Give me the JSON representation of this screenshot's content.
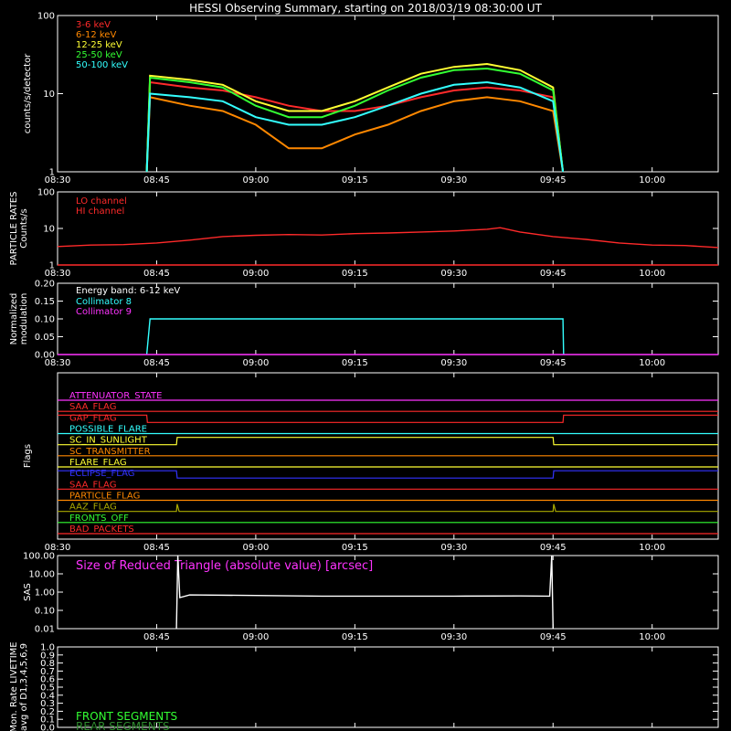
{
  "title": "HESSI Observing Summary, starting on 2018/03/19 08:30:00 UT",
  "time_ticks": [
    "08:30",
    "08:45",
    "09:00",
    "09:15",
    "09:30",
    "09:45",
    "10:00"
  ],
  "chart_data": [
    {
      "type": "line",
      "name": "count-rates",
      "ylabel": "counts/s/detector",
      "yscale": "log",
      "ylim": [
        1,
        100
      ],
      "yticks": [
        "1",
        "10",
        "100"
      ],
      "x_unit": "minutes since 08:30",
      "xlim": [
        0,
        100
      ],
      "legend_position": "top-left",
      "series": [
        {
          "name": "3-6 keV",
          "color": "#ff2a2a",
          "values": [
            [
              13.5,
              1
            ],
            [
              14,
              14
            ],
            [
              20,
              12
            ],
            [
              25,
              11
            ],
            [
              30,
              9
            ],
            [
              35,
              7
            ],
            [
              40,
              6
            ],
            [
              45,
              6
            ],
            [
              50,
              7
            ],
            [
              55,
              9
            ],
            [
              60,
              11
            ],
            [
              65,
              12
            ],
            [
              70,
              11
            ],
            [
              75,
              9
            ],
            [
              76.5,
              1
            ]
          ]
        },
        {
          "name": "6-12 keV",
          "color": "#ff8800",
          "values": [
            [
              13.5,
              1
            ],
            [
              14,
              9
            ],
            [
              20,
              7
            ],
            [
              25,
              6
            ],
            [
              30,
              4
            ],
            [
              35,
              2
            ],
            [
              40,
              2
            ],
            [
              45,
              3
            ],
            [
              50,
              4
            ],
            [
              55,
              6
            ],
            [
              60,
              8
            ],
            [
              65,
              9
            ],
            [
              70,
              8
            ],
            [
              75,
              6
            ],
            [
              76.5,
              1
            ]
          ]
        },
        {
          "name": "12-25 keV",
          "color": "#ffff33",
          "values": [
            [
              13.5,
              1
            ],
            [
              14,
              17
            ],
            [
              20,
              15
            ],
            [
              25,
              13
            ],
            [
              30,
              8
            ],
            [
              35,
              6
            ],
            [
              40,
              6
            ],
            [
              45,
              8
            ],
            [
              50,
              12
            ],
            [
              55,
              18
            ],
            [
              60,
              22
            ],
            [
              65,
              24
            ],
            [
              70,
              20
            ],
            [
              75,
              12
            ],
            [
              76.5,
              1
            ]
          ]
        },
        {
          "name": "25-50 keV",
          "color": "#33ff33",
          "values": [
            [
              13.5,
              1
            ],
            [
              14,
              16
            ],
            [
              20,
              14
            ],
            [
              25,
              12
            ],
            [
              30,
              7
            ],
            [
              35,
              5
            ],
            [
              40,
              5
            ],
            [
              45,
              7
            ],
            [
              50,
              11
            ],
            [
              55,
              16
            ],
            [
              60,
              20
            ],
            [
              65,
              21
            ],
            [
              70,
              18
            ],
            [
              75,
              11
            ],
            [
              76.5,
              1
            ]
          ]
        },
        {
          "name": "50-100 keV",
          "color": "#33ffff",
          "values": [
            [
              13.5,
              1
            ],
            [
              14,
              10
            ],
            [
              20,
              9
            ],
            [
              25,
              8
            ],
            [
              30,
              5
            ],
            [
              35,
              4
            ],
            [
              40,
              4
            ],
            [
              45,
              5
            ],
            [
              50,
              7
            ],
            [
              55,
              10
            ],
            [
              60,
              13
            ],
            [
              65,
              14
            ],
            [
              70,
              12
            ],
            [
              75,
              8
            ],
            [
              76.5,
              1
            ]
          ]
        }
      ]
    },
    {
      "type": "line",
      "name": "particle-rates",
      "ylabel": "PARTICLE RATES Counts/s",
      "yscale": "log",
      "ylim": [
        1,
        100
      ],
      "yticks": [
        "1",
        "10",
        "100"
      ],
      "x_unit": "minutes since 08:30",
      "xlim": [
        0,
        100
      ],
      "legend_position": "top-left",
      "series": [
        {
          "name": "LO channel",
          "color": "#ff2a2a",
          "values": [
            [
              0,
              3.2
            ],
            [
              5,
              3.5
            ],
            [
              10,
              3.6
            ],
            [
              15,
              4.0
            ],
            [
              20,
              4.8
            ],
            [
              25,
              6.0
            ],
            [
              30,
              6.5
            ],
            [
              35,
              6.8
            ],
            [
              40,
              6.6
            ],
            [
              45,
              7.2
            ],
            [
              50,
              7.5
            ],
            [
              55,
              8.0
            ],
            [
              60,
              8.5
            ],
            [
              65,
              9.5
            ],
            [
              67,
              10.5
            ],
            [
              70,
              8
            ],
            [
              75,
              6
            ],
            [
              80,
              5
            ],
            [
              85,
              4
            ],
            [
              90,
              3.5
            ],
            [
              95,
              3.4
            ],
            [
              100,
              3.0
            ]
          ]
        },
        {
          "name": "HI channel",
          "color": "#ff2a2a",
          "values": [
            [
              0,
              1
            ],
            [
              100,
              1
            ]
          ]
        }
      ]
    },
    {
      "type": "line",
      "name": "modulation",
      "ylabel": "Normalized modulation",
      "yscale": "linear",
      "ylim": [
        0,
        0.2
      ],
      "yticks": [
        "0.00",
        "0.05",
        "0.10",
        "0.15",
        "0.20"
      ],
      "x_unit": "minutes since 08:30",
      "xlim": [
        0,
        100
      ],
      "annotation": "Energy band: 6-12 keV",
      "legend_position": "top-left",
      "series": [
        {
          "name": "Collimator 8",
          "color": "#33ffff",
          "values": [
            [
              13.5,
              0
            ],
            [
              14,
              0.1
            ],
            [
              76.5,
              0.1
            ],
            [
              76.6,
              0
            ]
          ]
        },
        {
          "name": "Collimator 9",
          "color": "#ff33ff",
          "values": [
            [
              0,
              0
            ],
            [
              100,
              0
            ]
          ]
        }
      ]
    },
    {
      "type": "line",
      "name": "flags",
      "ylabel": "Flags",
      "x_unit": "minutes since 08:30",
      "xlim": [
        0,
        100
      ],
      "series": [
        {
          "name": "ATTENUATOR_STATE",
          "color": "#ff33ff",
          "values": [
            [
              0,
              0
            ],
            [
              100,
              0
            ]
          ]
        },
        {
          "name": "SAA_FLAG",
          "color": "#ff2a2a",
          "values": [
            [
              0,
              0
            ],
            [
              100,
              0
            ]
          ]
        },
        {
          "name": "GAP_FLAG",
          "color": "#ff2a2a",
          "values": [
            [
              0,
              1
            ],
            [
              13.5,
              1
            ],
            [
              13.6,
              0
            ],
            [
              76.5,
              0
            ],
            [
              76.6,
              1
            ],
            [
              100,
              1
            ]
          ]
        },
        {
          "name": "POSSIBLE_FLARE",
          "color": "#33ffff",
          "values": [
            [
              0,
              0
            ],
            [
              100,
              0
            ]
          ]
        },
        {
          "name": "SC_IN_SUNLIGHT",
          "color": "#ffff33",
          "values": [
            [
              0,
              0
            ],
            [
              18,
              0
            ],
            [
              18.1,
              1
            ],
            [
              75,
              1
            ],
            [
              75.1,
              0
            ],
            [
              100,
              0
            ]
          ]
        },
        {
          "name": "SC_TRANSMITTER",
          "color": "#ff8800",
          "values": [
            [
              0,
              0
            ],
            [
              100,
              0
            ]
          ]
        },
        {
          "name": "FLARE_FLAG",
          "color": "#ffff33",
          "values": [
            [
              0,
              0
            ],
            [
              100,
              0
            ]
          ]
        },
        {
          "name": "ECLIPSE_FLAG",
          "color": "#3333ff",
          "values": [
            [
              0,
              1
            ],
            [
              18,
              1
            ],
            [
              18.1,
              0
            ],
            [
              75,
              0
            ],
            [
              75.1,
              1
            ],
            [
              100,
              1
            ]
          ]
        },
        {
          "name": "SAA_FLAG",
          "color": "#ff2a2a",
          "values": [
            [
              0,
              0
            ],
            [
              100,
              0
            ]
          ]
        },
        {
          "name": "PARTICLE_FLAG",
          "color": "#ff8800",
          "values": [
            [
              0,
              0
            ],
            [
              100,
              0
            ]
          ]
        },
        {
          "name": "AAZ_FLAG",
          "color": "#aaaa00",
          "values": [
            [
              0,
              0
            ],
            [
              18,
              0
            ],
            [
              18.1,
              1
            ],
            [
              18.4,
              0
            ],
            [
              75,
              0
            ],
            [
              75.1,
              1
            ],
            [
              75.4,
              0
            ],
            [
              100,
              0
            ]
          ]
        },
        {
          "name": "FRONTS_OFF",
          "color": "#33ff33",
          "values": [
            [
              0,
              0
            ],
            [
              100,
              0
            ]
          ]
        },
        {
          "name": "BAD_PACKETS",
          "color": "#ff2a2a",
          "values": [
            [
              0,
              0
            ],
            [
              100,
              0
            ]
          ]
        }
      ]
    },
    {
      "type": "line",
      "name": "sas",
      "ylabel": "SAS",
      "yscale": "log",
      "ylim": [
        0.01,
        100
      ],
      "yticks": [
        "0.01",
        "0.10",
        "1.00",
        "10.00",
        "100.00"
      ],
      "x_unit": "minutes since 08:30",
      "xlim": [
        0,
        100
      ],
      "annotation": "Size of Reduced Triangle (absolute value) [arcsec]",
      "series": [
        {
          "name": "sas",
          "color": "#ffffff",
          "values": [
            [
              18,
              0.01
            ],
            [
              18.2,
              100
            ],
            [
              18.5,
              0.5
            ],
            [
              20,
              0.7
            ],
            [
              30,
              0.65
            ],
            [
              40,
              0.6
            ],
            [
              50,
              0.6
            ],
            [
              60,
              0.6
            ],
            [
              70,
              0.62
            ],
            [
              74.5,
              0.6
            ],
            [
              74.8,
              100
            ],
            [
              75,
              0.01
            ]
          ]
        }
      ]
    },
    {
      "type": "line",
      "name": "livetime",
      "ylabel": "Mon. Rate LIVETIME avg of D1,3,4,5,6,9",
      "yscale": "linear",
      "ylim": [
        0,
        1
      ],
      "yticks": [
        "0.0",
        "0.1",
        "0.2",
        "0.3",
        "0.4",
        "0.5",
        "0.6",
        "0.7",
        "0.8",
        "0.9",
        "1.0"
      ],
      "x_unit": "minutes since 08:30",
      "xlim": [
        0,
        100
      ],
      "legend_position": "bottom-left",
      "series": [
        {
          "name": "FRONT SEGMENTS",
          "color": "#33ff33",
          "values": []
        },
        {
          "name": "REAR SEGMENTS",
          "color": "#2e8b2e",
          "values": []
        }
      ]
    }
  ],
  "colors": {
    "background": "#000000",
    "axes": "#ffffff"
  }
}
